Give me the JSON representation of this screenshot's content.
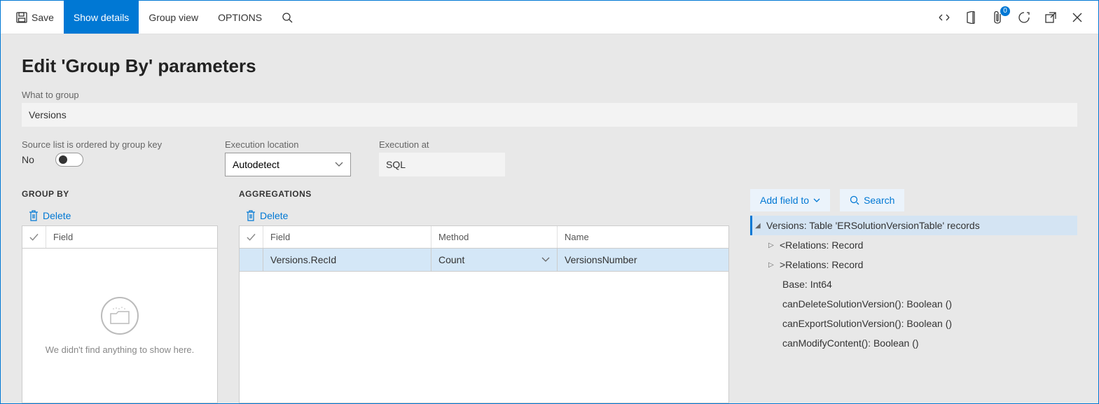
{
  "toolbar": {
    "save": "Save",
    "show_details": "Show details",
    "group_view": "Group view",
    "options": "OPTIONS",
    "badge": "0"
  },
  "page": {
    "title": "Edit 'Group By' parameters",
    "what_to_group_label": "What to group",
    "what_to_group_value": "Versions",
    "ordered_label": "Source list is ordered by group key",
    "ordered_value": "No",
    "exec_loc_label": "Execution location",
    "exec_loc_value": "Autodetect",
    "exec_at_label": "Execution at",
    "exec_at_value": "SQL"
  },
  "groupby": {
    "title": "GROUP BY",
    "delete": "Delete",
    "header_field": "Field",
    "empty": "We didn't find anything to show here."
  },
  "agg": {
    "title": "AGGREGATIONS",
    "delete": "Delete",
    "header_field": "Field",
    "header_method": "Method",
    "header_name": "Name",
    "row": {
      "field": "Versions.RecId",
      "method": "Count",
      "name": "VersionsNumber"
    }
  },
  "tree": {
    "add_field": "Add field to",
    "search": "Search",
    "root": "Versions: Table 'ERSolutionVersionTable' records",
    "rel_in": "<Relations: Record",
    "rel_out": ">Relations: Record",
    "items": [
      "Base: Int64",
      "canDeleteSolutionVersion(): Boolean ()",
      "canExportSolutionVersion(): Boolean ()",
      "canModifyContent(): Boolean ()"
    ]
  }
}
